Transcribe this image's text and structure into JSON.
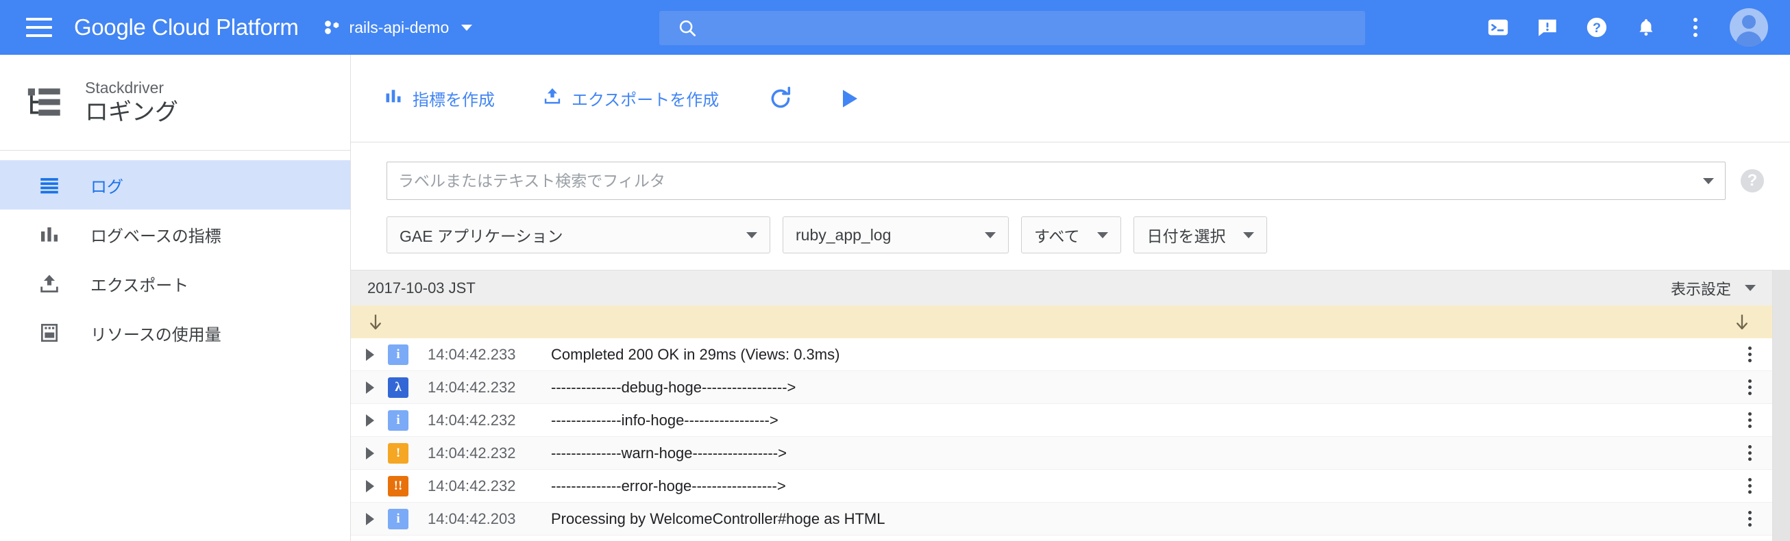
{
  "header": {
    "menu_icon": "hamburger-menu-icon",
    "brand": "Google Cloud Platform",
    "project_icon": "project-selector-icon",
    "project_name": "rails-api-demo",
    "search": {
      "value": "",
      "placeholder": "",
      "icon": "search-icon"
    },
    "icons": [
      {
        "name": "cloud-shell-icon",
        "label": "Cloud Shell"
      },
      {
        "name": "feedback-icon",
        "label": "Feedback"
      },
      {
        "name": "help-icon",
        "label": "Help"
      },
      {
        "name": "notifications-bell-icon",
        "label": "Notifications"
      },
      {
        "name": "more-options-icon",
        "label": "More"
      }
    ],
    "avatar": "user-avatar"
  },
  "sidebar": {
    "product_sub": "Stackdriver",
    "product_name": "ロギング",
    "product_icon": "stackdriver-logging-icon",
    "items": [
      {
        "label": "ログ",
        "icon": "logs-icon",
        "active": true
      },
      {
        "label": "ログベースの指標",
        "icon": "bar-chart-icon",
        "active": false
      },
      {
        "label": "エクスポート",
        "icon": "export-upload-icon",
        "active": false
      },
      {
        "label": "リソースの使用量",
        "icon": "resource-usage-icon",
        "active": false
      }
    ]
  },
  "toolbar": {
    "create_metric": "指標を作成",
    "create_metric_icon": "bar-chart-icon",
    "create_export": "エクスポートを作成",
    "create_export_icon": "export-upload-icon",
    "refresh_icon": "refresh-icon",
    "play_icon": "play-icon"
  },
  "filter": {
    "placeholder": "ラベルまたはテキスト検索でフィルタ",
    "value": "",
    "dropdown_icon": "chevron-down-icon",
    "help_icon": "help-circle-icon",
    "help_glyph": "?"
  },
  "selects": [
    {
      "name": "resource-select",
      "value": "GAE アプリケーション",
      "width": "wide"
    },
    {
      "name": "log-name-select",
      "value": "ruby_app_log",
      "width": "wide"
    },
    {
      "name": "severity-select",
      "value": "すべて",
      "width": "auto"
    },
    {
      "name": "date-select",
      "value": "日付を選択",
      "width": "auto"
    }
  ],
  "log_table": {
    "date_header": "2017-10-03 JST",
    "display_settings": "表示設定",
    "jump_arrow_icon": "arrow-down-icon",
    "rows": [
      {
        "severity": "info",
        "glyph": "i",
        "color": "#7baaf7",
        "time": "14:04:42.233",
        "message": "Completed 200 OK in 29ms (Views: 0.3ms)"
      },
      {
        "severity": "debug",
        "glyph": "λ",
        "color": "#3367d6",
        "time": "14:04:42.232",
        "message": "--------------debug-hoge----------------->"
      },
      {
        "severity": "info",
        "glyph": "i",
        "color": "#7baaf7",
        "time": "14:04:42.232",
        "message": "--------------info-hoge----------------->"
      },
      {
        "severity": "warning",
        "glyph": "!",
        "color": "#f5a623",
        "time": "14:04:42.232",
        "message": "--------------warn-hoge----------------->"
      },
      {
        "severity": "error",
        "glyph": "!!",
        "color": "#e8710a",
        "time": "14:04:42.232",
        "message": "--------------error-hoge----------------->"
      },
      {
        "severity": "info",
        "glyph": "i",
        "color": "#7baaf7",
        "time": "14:04:42.203",
        "message": "Processing by WelcomeController#hoge as HTML"
      }
    ]
  },
  "colors": {
    "brand_blue": "#4285f4",
    "accent_blue": "#1a73e8",
    "active_nav_bg": "#d3e1fb",
    "jump_bar_bg": "#f8ecc8",
    "row_alt_bg": "#fafafa"
  }
}
